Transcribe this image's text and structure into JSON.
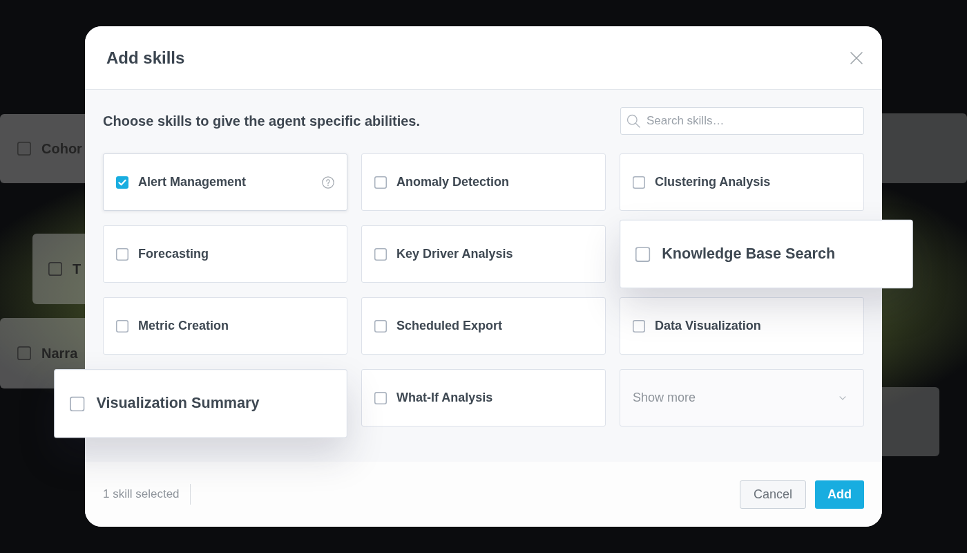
{
  "backdrop_cards": [
    {
      "label": "Cohor",
      "checked": false
    },
    {
      "label": "T",
      "checked": false
    },
    {
      "label": "Narra",
      "checked": false
    }
  ],
  "dialog": {
    "title": "Add skills",
    "description": "Choose skills to give the agent specific abilities.",
    "search": {
      "placeholder": "Search skills…"
    },
    "skills": [
      {
        "kind": "skill",
        "label": "Alert Management",
        "checked": true,
        "raised": false,
        "help": true
      },
      {
        "kind": "skill",
        "label": "Anomaly Detection",
        "checked": false,
        "raised": false,
        "help": false
      },
      {
        "kind": "skill",
        "label": "Clustering Analysis",
        "checked": false,
        "raised": false,
        "help": false
      },
      {
        "kind": "skill",
        "label": "Forecasting",
        "checked": false,
        "raised": false,
        "help": false
      },
      {
        "kind": "skill",
        "label": "Key Driver Analysis",
        "checked": false,
        "raised": false,
        "help": false
      },
      {
        "kind": "skill",
        "label": "Knowledge Base Search",
        "checked": false,
        "raised": true,
        "help": false
      },
      {
        "kind": "skill",
        "label": "Metric Creation",
        "checked": false,
        "raised": false,
        "help": false
      },
      {
        "kind": "skill",
        "label": "Scheduled Export",
        "checked": false,
        "raised": false,
        "help": false
      },
      {
        "kind": "skill",
        "label": "Data Visualization",
        "checked": false,
        "raised": false,
        "help": false
      },
      {
        "kind": "skill",
        "label": "Visualization Summary",
        "checked": false,
        "raised": true,
        "help": false
      },
      {
        "kind": "skill",
        "label": "What-If Analysis",
        "checked": false,
        "raised": false,
        "help": false
      },
      {
        "kind": "show_more",
        "label": "Show more"
      }
    ],
    "footer": {
      "selection_count": "1 skill selected",
      "buttons": [
        {
          "label": "Cancel",
          "kind": "cancel"
        },
        {
          "label": "Add",
          "kind": "confirm"
        }
      ]
    }
  }
}
